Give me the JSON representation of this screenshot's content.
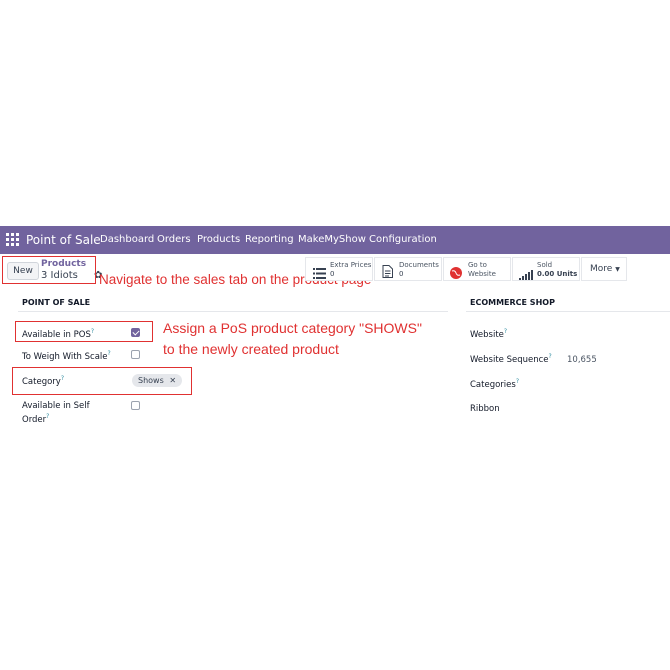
{
  "navbar": {
    "app_name": "Point of Sale",
    "menu": [
      "Dashboard",
      "Orders",
      "Products",
      "Reporting",
      "MakeMyShow",
      "Configuration"
    ]
  },
  "control_panel": {
    "new_label": "New",
    "breadcrumb_parent": "Products",
    "record_name": "3 Idiots",
    "gear_icon": "gear-icon",
    "smart_buttons": {
      "extra_prices": {
        "label": "Extra Prices",
        "value": "0"
      },
      "documents": {
        "label": "Documents",
        "value": "0"
      },
      "go_to_website": {
        "line1": "Go to",
        "line2": "Website"
      },
      "sold": {
        "label": "Sold",
        "value": "0.00 Units"
      },
      "more": "More"
    }
  },
  "annotations": {
    "navigate": "Navigate to the sales tab on the product page",
    "assign_line1": "Assign a PoS product category \"SHOWS\"",
    "assign_line2": "to the newly created product"
  },
  "pos_section": {
    "title": "POINT OF SALE",
    "available_in_pos": {
      "label": "Available in POS",
      "checked": true
    },
    "to_weigh": {
      "label": "To Weigh With Scale",
      "checked": false
    },
    "category": {
      "label": "Category",
      "tag": "Shows"
    },
    "self_order": {
      "label_line1": "Available in Self",
      "label_line2": "Order",
      "checked": false
    }
  },
  "ecommerce_section": {
    "title": "ECOMMERCE SHOP",
    "website_label": "Website",
    "sequence_label": "Website Sequence",
    "sequence_value": "10,655",
    "categories_label": "Categories",
    "ribbon_label": "Ribbon"
  },
  "colors": {
    "navbar": "#71639e",
    "annotation": "#e03131",
    "checkbox_checked": "#71639e"
  },
  "help_mark": "?"
}
